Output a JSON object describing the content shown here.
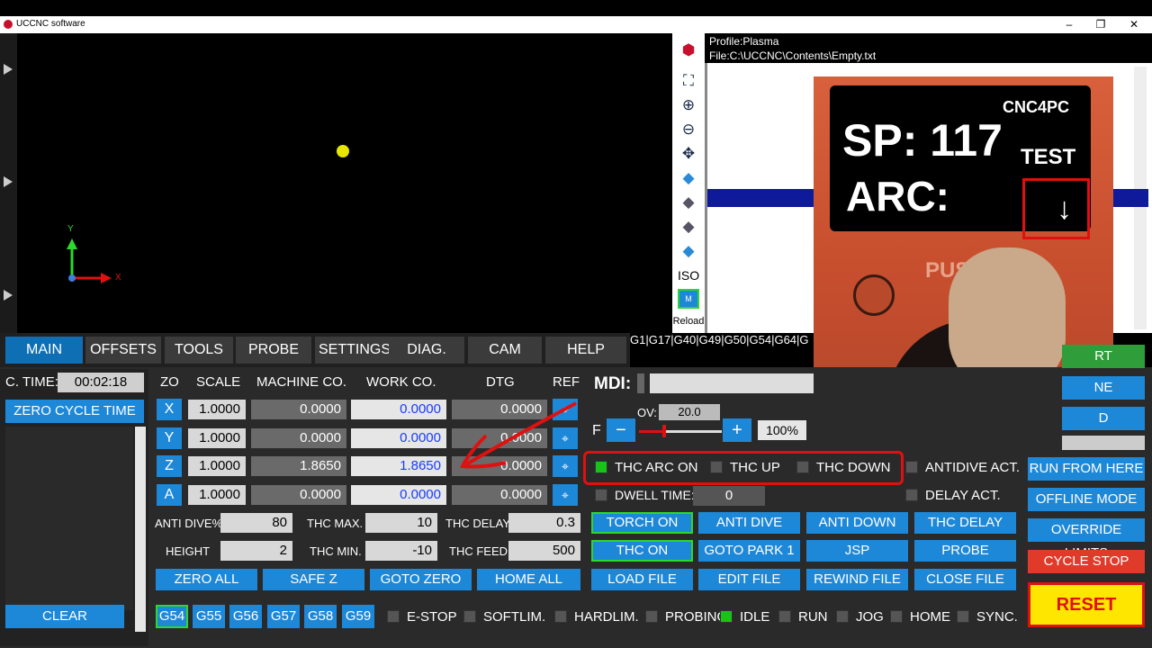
{
  "window": {
    "title": "UCCNC software",
    "min": "–",
    "max": "❐",
    "close": "✕"
  },
  "viewport": {
    "axis_y": "Y",
    "axis_x": "X"
  },
  "view_tools": {
    "iso": "ISO",
    "reload": "Reload",
    "m_label": "M"
  },
  "profile": {
    "profile_line": "Profile:Plasma",
    "file_line": "File:C:\\UCCNC\\Contents\\Empty.txt"
  },
  "overlay_photo": {
    "sp_text": "SP: 117",
    "arc_text": "ARC:",
    "brand": "CNC4PC",
    "test": "TEST",
    "push": "PUS"
  },
  "tabs": [
    "MAIN",
    "OFFSETS",
    "TOOLS",
    "PROBE",
    "SETTINGS",
    "DIAG.",
    "CAM",
    "HELP"
  ],
  "gcode_modes": "G1|G17|G40|G49|G50|G54|G64|G",
  "cycle": {
    "label": "C. TIME:",
    "value": "00:02:18",
    "zero_btn": "ZERO CYCLE TIME",
    "clear_btn": "CLEAR"
  },
  "dro_headers": {
    "zo": "ZO",
    "scale": "SCALE",
    "machine": "MACHINE CO.",
    "work": "WORK CO.",
    "dtg": "DTG",
    "ref": "REF"
  },
  "axes": [
    {
      "name": "X",
      "scale": "1.0000",
      "machine": "0.0000",
      "work": "0.0000",
      "dtg": "0.0000"
    },
    {
      "name": "Y",
      "scale": "1.0000",
      "machine": "0.0000",
      "work": "0.0000",
      "dtg": "0.0000"
    },
    {
      "name": "Z",
      "scale": "1.0000",
      "machine": "1.8650",
      "work": "1.8650",
      "dtg": "0.0000"
    },
    {
      "name": "A",
      "scale": "1.0000",
      "machine": "0.0000",
      "work": "0.0000",
      "dtg": "0.0000"
    }
  ],
  "params": {
    "antidive_label": "ANTI DIVE%",
    "antidive": "80",
    "height_label": "HEIGHT",
    "height": "2",
    "thcmax_label": "THC MAX.",
    "thcmax": "10",
    "thcmin_label": "THC MIN.",
    "thcmin": "-10",
    "thcdelay_label": "THC DELAY",
    "thcdelay": "0.3",
    "thcfeed_label": "THC FEED",
    "thcfeed": "500"
  },
  "dro_buttons": {
    "zero_all": "ZERO ALL",
    "safe_z": "SAFE Z",
    "goto_zero": "GOTO ZERO",
    "home_all": "HOME ALL"
  },
  "work_offsets": [
    "G54",
    "G55",
    "G56",
    "G57",
    "G58",
    "G59"
  ],
  "mdi": {
    "label": "MDI:"
  },
  "feed": {
    "f_label": "F",
    "ov_label": "OV:",
    "ov_value": "20.0",
    "minus": "−",
    "plus": "+",
    "percent": "100%",
    "slider_percent": 30
  },
  "thc_status": {
    "arc_on": "THC ARC ON",
    "up": "THC UP",
    "down": "THC DOWN",
    "antidive_act": "ANTIDIVE ACT.",
    "dwell_label": "DWELL TIME:",
    "dwell_value": "0",
    "delay_act": "DELAY ACT."
  },
  "action_buttons": [
    [
      "TORCH ON",
      "ANTI DIVE",
      "ANTI DOWN",
      "THC DELAY"
    ],
    [
      "THC ON",
      "GOTO PARK 1",
      "JSP",
      "PROBE"
    ],
    [
      "LOAD FILE",
      "EDIT FILE",
      "REWIND FILE",
      "CLOSE FILE"
    ]
  ],
  "side_buttons": {
    "rt": "RT",
    "ne": "NE",
    "d": "D",
    "run_from_here": "RUN FROM HERE",
    "offline_mode": "OFFLINE MODE",
    "override_limits": "OVERRIDE LIMITS",
    "cycle_stop": "CYCLE STOP",
    "reset": "RESET"
  },
  "status_bar": [
    "E-STOP",
    "SOFTLIM.",
    "HARDLIM.",
    "PROBING",
    "IDLE",
    "RUN",
    "JOG",
    "HOME",
    "SYNC."
  ],
  "colors": {
    "accent": "#1e88d8",
    "active_led": "#17c417",
    "reset_bg": "#ffe600",
    "reset_fg": "#e01010",
    "annotation": "#e01010"
  }
}
